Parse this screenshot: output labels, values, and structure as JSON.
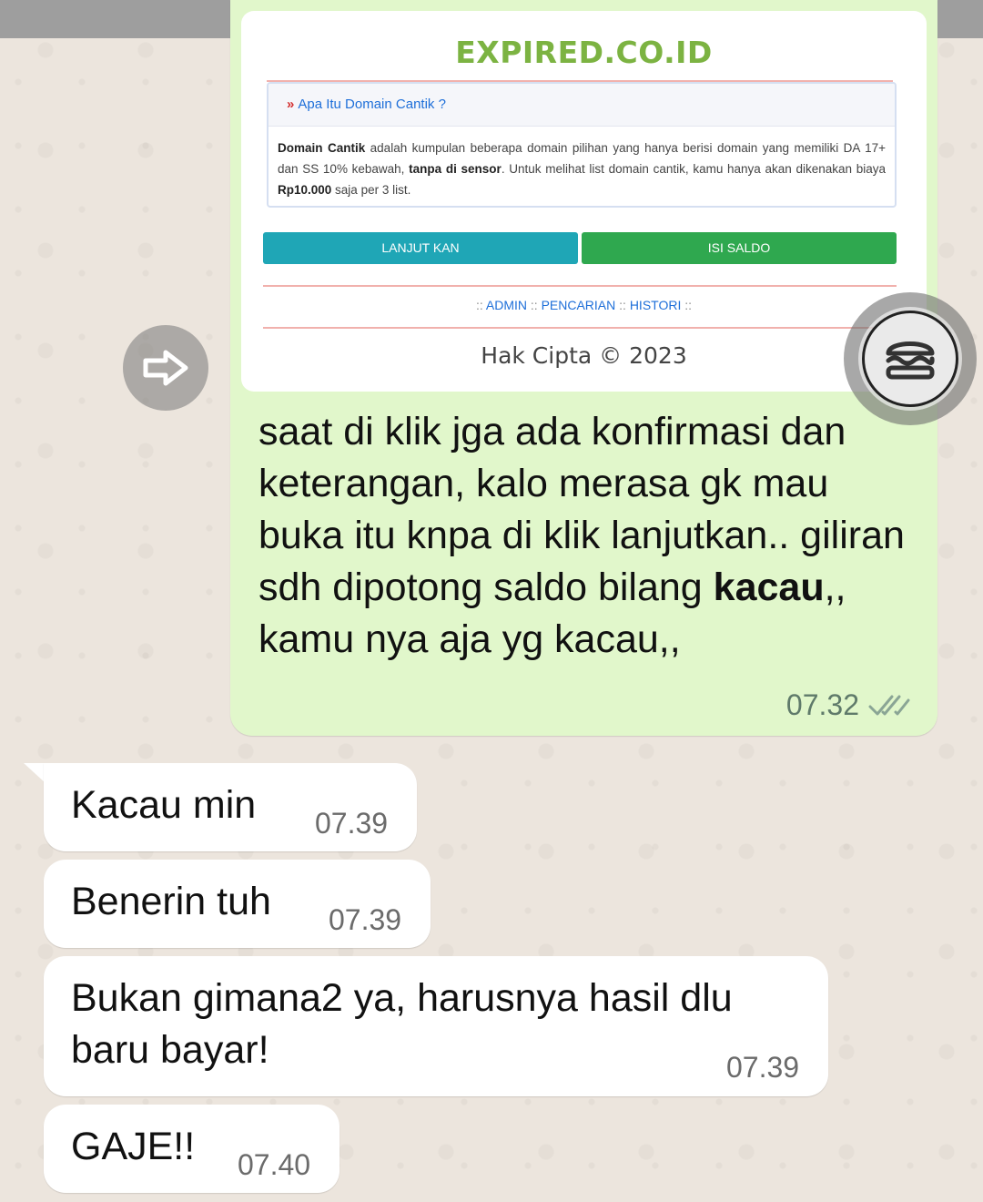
{
  "shared_screenshot": {
    "site_title": "EXPIRED.CO.ID",
    "info_heading": "Apa Itu Domain Cantik ?",
    "info_body_parts": {
      "p1_bold": "Domain Cantik",
      "p2": " adalah kumpulan beberapa domain pilihan yang hanya berisi domain yang memiliki DA 17+ dan SS 10% kebawah, ",
      "p3_bold": "tanpa di sensor",
      "p4": ". Untuk melihat list domain cantik, kamu hanya akan dikenakan biaya ",
      "p5_bold": "Rp10.000",
      "p6": " saja per 3 list."
    },
    "btn_continue": "LANJUT KAN",
    "btn_topup": "ISI SALDO",
    "nav_sep": "::",
    "nav_links": [
      "ADMIN",
      "PENCARIAN",
      "HISTORI"
    ],
    "copyright": "Hak Cipta © 2023"
  },
  "outgoing": {
    "text_before_bold": "saat di klik jga ada konfirmasi dan keterangan, kalo merasa gk mau buka itu knpa di klik lanjutkan.. giliran sdh dipotong saldo bilang ",
    "text_bold": "kacau",
    "text_after_bold": ",, kamu nya aja yg kacau,,",
    "time": "07.32",
    "status": "read"
  },
  "incoming": [
    {
      "text": "Kacau min",
      "time": "07.39"
    },
    {
      "text": "Benerin tuh",
      "time": "07.39"
    },
    {
      "text_line1": "Bukan gimana2 ya, harusnya hasil dlu",
      "text_line2": "baru bayar!",
      "time": "07.39"
    },
    {
      "text": "GAJE!!",
      "time": "07.40"
    }
  ],
  "icons": {
    "forward": "forward-arrow-icon",
    "floating": "burger-icon",
    "read_ticks": "double-check-icon"
  },
  "colors": {
    "outgoing_bubble": "#e1f7cb",
    "incoming_bubble": "#ffffff",
    "site_title": "#7cb342",
    "btn_continue": "#1fa6b6",
    "btn_topup": "#2fa84f",
    "read_ticks": "#8aa595"
  }
}
